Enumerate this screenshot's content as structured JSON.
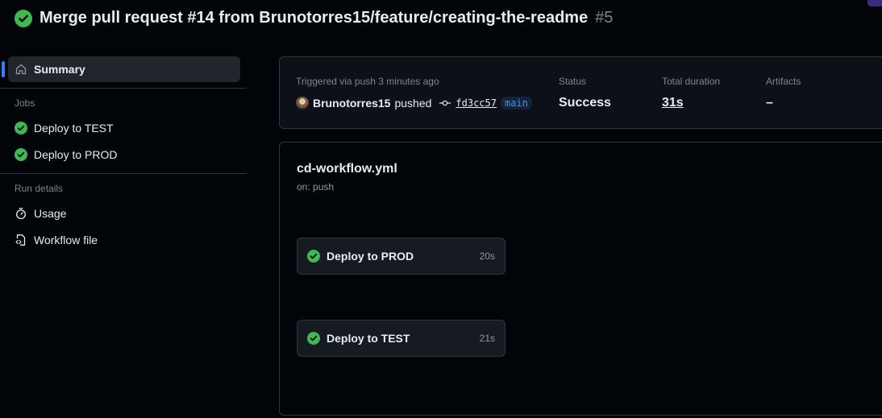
{
  "run": {
    "title": "Merge pull request #14 from Brunotorres15/feature/creating-the-readme",
    "number": "#5",
    "status_icon": "check-circle-fill-icon"
  },
  "sidebar": {
    "summary_label": "Summary",
    "jobs_heading": "Jobs",
    "jobs": [
      {
        "label": "Deploy to TEST",
        "icon": "check-circle-fill-icon"
      },
      {
        "label": "Deploy to PROD",
        "icon": "check-circle-fill-icon"
      }
    ],
    "run_details_heading": "Run details",
    "run_details": [
      {
        "label": "Usage",
        "icon": "stopwatch-icon"
      },
      {
        "label": "Workflow file",
        "icon": "file-code-icon"
      }
    ]
  },
  "summary": {
    "trigger_label": "Triggered via push 3 minutes ago",
    "user": "Brunotorres15",
    "action": "pushed",
    "commit_sha": "fd3cc57",
    "branch": "main",
    "status_label": "Status",
    "status_value": "Success",
    "duration_label": "Total duration",
    "duration_value": "31s",
    "artifacts_label": "Artifacts",
    "artifacts_value": "–"
  },
  "workflow": {
    "file_name": "cd-workflow.yml",
    "trigger": "on: push",
    "jobs": [
      {
        "name": "Deploy to PROD",
        "duration": "20s"
      },
      {
        "name": "Deploy to TEST",
        "duration": "21s"
      }
    ]
  },
  "colors": {
    "success": "#3fb950",
    "accent": "#2f81f7",
    "background": "#010409",
    "border": "#30363d"
  }
}
